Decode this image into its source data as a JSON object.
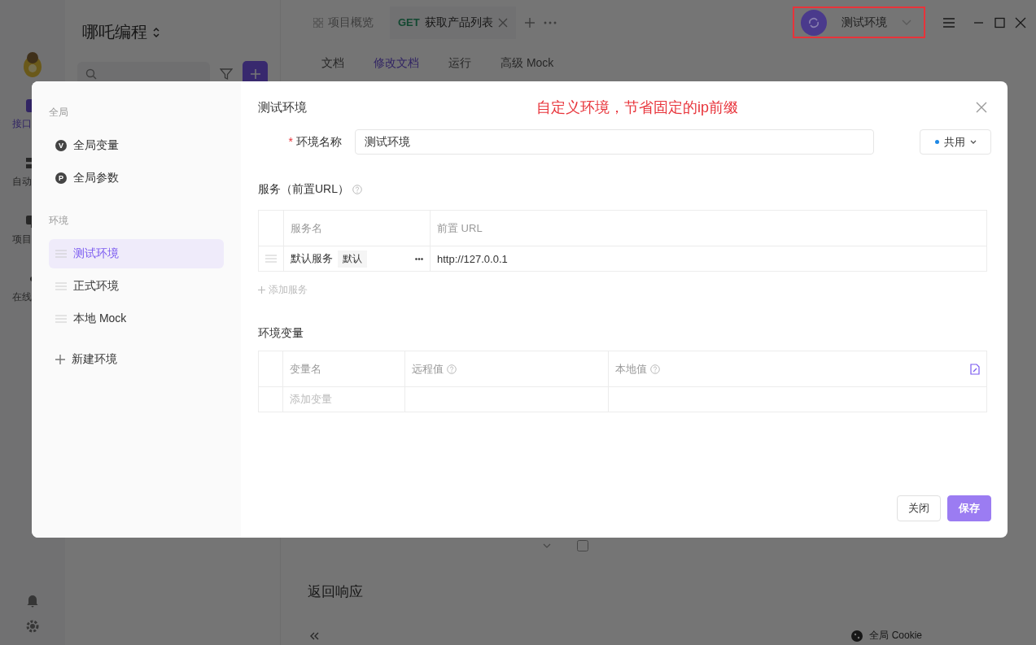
{
  "app": {
    "project": "哪吒编程",
    "rail": [
      {
        "label": "接口",
        "selected": true
      },
      {
        "label": "自动",
        "selected": false
      },
      {
        "label": "项目",
        "selected": false
      },
      {
        "label": "在线",
        "selected": false
      }
    ],
    "tabs": [
      {
        "label": "项目概览",
        "selected": false
      },
      {
        "method": "GET",
        "label": "获取产品列表",
        "selected": true
      }
    ],
    "subtabs": [
      {
        "label": "文档",
        "selected": false
      },
      {
        "label": "修改文档",
        "selected": true
      },
      {
        "label": "运行",
        "selected": false
      },
      {
        "label": "高级 Mock",
        "selected": false
      }
    ],
    "environment": "测试环境",
    "param_row": {
      "required_checked": false
    },
    "response_title": "返回响应",
    "status_bar": {
      "cookie": "全局 Cookie"
    }
  },
  "dialog": {
    "sections": [
      {
        "title": "全局",
        "items": [
          {
            "kind": "global",
            "badge": "V",
            "label": "全局变量",
            "selected": false
          },
          {
            "kind": "global",
            "badge": "P",
            "label": "全局参数",
            "selected": false
          }
        ]
      },
      {
        "title": "环境",
        "items": [
          {
            "kind": "env",
            "label": "测试环境",
            "selected": true
          },
          {
            "kind": "env",
            "label": "正式环境",
            "selected": false
          },
          {
            "kind": "env",
            "label": "本地 Mock",
            "selected": false
          }
        ]
      }
    ],
    "new_env": "新建环境",
    "title": "测试环境",
    "annotation": "自定义环境，节省固定的ip前缀",
    "required_mark": "*",
    "name_label": "环境名称",
    "name_value": "测试环境",
    "scope": "共用",
    "services_title": "服务（前置URL）",
    "service_columns": [
      "服务名",
      "前置 URL"
    ],
    "services": [
      {
        "name": "默认服务",
        "tag": "默认",
        "url": "http://127.0.0.1"
      }
    ],
    "add_service": "添加服务",
    "vars_title": "环境变量",
    "var_columns": [
      {
        "label": "变量名",
        "help": false
      },
      {
        "label": "远程值",
        "help": true
      },
      {
        "label": "本地值",
        "help": true
      }
    ],
    "var_placeholder": "添加变量",
    "buttons": [
      {
        "kind": "secondary",
        "label": "关闭"
      },
      {
        "kind": "primary",
        "label": "保存"
      }
    ]
  }
}
